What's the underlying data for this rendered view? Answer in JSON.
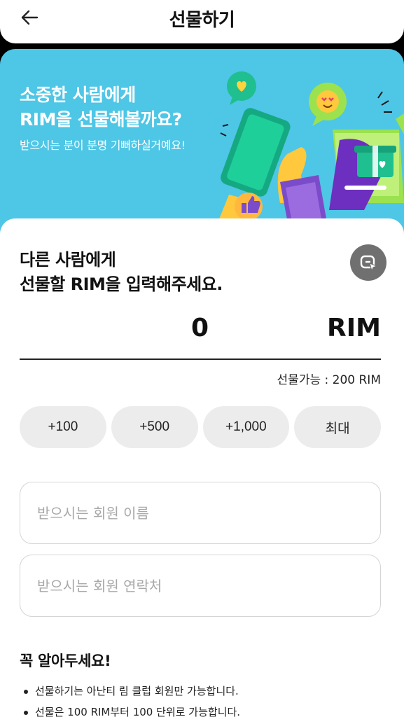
{
  "header": {
    "title": "선물하기"
  },
  "banner": {
    "title_line1": "소중한 사람에게",
    "title_line2": "RIM을 선물해볼까요?",
    "subtitle": "받으시는 분이 분명 기뻐하실거예요!"
  },
  "form": {
    "prompt_line1": "다른 사람에게",
    "prompt_line2": "선물할 RIM을 입력해주세요.",
    "amount_value": "0",
    "amount_unit": "RIM",
    "available": "선물가능 : 200 RIM",
    "quick_buttons": [
      "+100",
      "+500",
      "+1,000",
      "최대"
    ],
    "name_placeholder": "받으시는 회원 이름",
    "phone_placeholder": "받으시는 회원 연락처"
  },
  "notice": {
    "title": "꼭 알아두세요!",
    "items": [
      "선물하기는 아난티 림 클럽 회원만 가능합니다.",
      "선물은 100 RIM부터 100 단위로 가능합니다."
    ]
  },
  "colors": {
    "banner_bg": "#4ec6e6",
    "button_bg": "#ececec",
    "scan_button_bg": "#707070"
  },
  "icons": {
    "back": "arrow-left-icon",
    "scan": "qr-scan-icon"
  }
}
